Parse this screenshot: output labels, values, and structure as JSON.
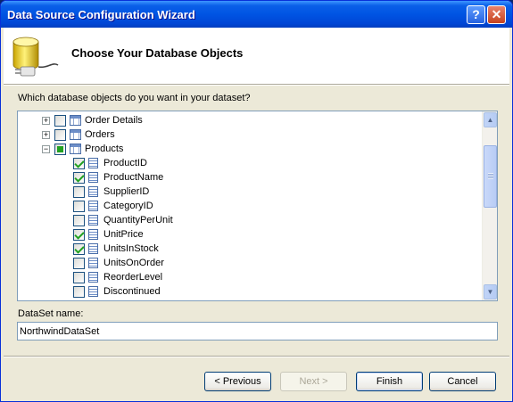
{
  "window": {
    "title": "Data Source Configuration Wizard",
    "help_label": "?",
    "close_label": "✕"
  },
  "header": {
    "title": "Choose Your Database Objects",
    "icon": "database-plug-icon"
  },
  "tree": {
    "prompt": "Which database objects do you want in your dataset?",
    "items": [
      {
        "label": "Order Details",
        "level": 1,
        "expander": "+",
        "check": "unchecked",
        "icon": "table-icon"
      },
      {
        "label": "Orders",
        "level": 1,
        "expander": "+",
        "check": "unchecked",
        "icon": "table-icon"
      },
      {
        "label": "Products",
        "level": 1,
        "expander": "−",
        "check": "partial",
        "icon": "table-icon"
      },
      {
        "label": "ProductID",
        "level": 2,
        "check": "checked",
        "icon": "column-icon"
      },
      {
        "label": "ProductName",
        "level": 2,
        "check": "checked",
        "icon": "column-icon"
      },
      {
        "label": "SupplierID",
        "level": 2,
        "check": "unchecked",
        "icon": "column-icon"
      },
      {
        "label": "CategoryID",
        "level": 2,
        "check": "unchecked",
        "icon": "column-icon"
      },
      {
        "label": "QuantityPerUnit",
        "level": 2,
        "check": "unchecked",
        "icon": "column-icon"
      },
      {
        "label": "UnitPrice",
        "level": 2,
        "check": "checked",
        "icon": "column-icon"
      },
      {
        "label": "UnitsInStock",
        "level": 2,
        "check": "checked",
        "icon": "column-icon"
      },
      {
        "label": "UnitsOnOrder",
        "level": 2,
        "check": "unchecked",
        "icon": "column-icon"
      },
      {
        "label": "ReorderLevel",
        "level": 2,
        "check": "unchecked",
        "icon": "column-icon"
      },
      {
        "label": "Discontinued",
        "level": 2,
        "check": "unchecked",
        "icon": "column-icon"
      }
    ]
  },
  "dataset": {
    "label": "DataSet name:",
    "value": "NorthwindDataSet"
  },
  "buttons": {
    "previous": "< Previous",
    "next": "Next >",
    "finish": "Finish",
    "cancel": "Cancel"
  },
  "colors": {
    "title_bar": "#0054e3",
    "check_green": "#21a121",
    "dialog_bg": "#ece9d8"
  }
}
